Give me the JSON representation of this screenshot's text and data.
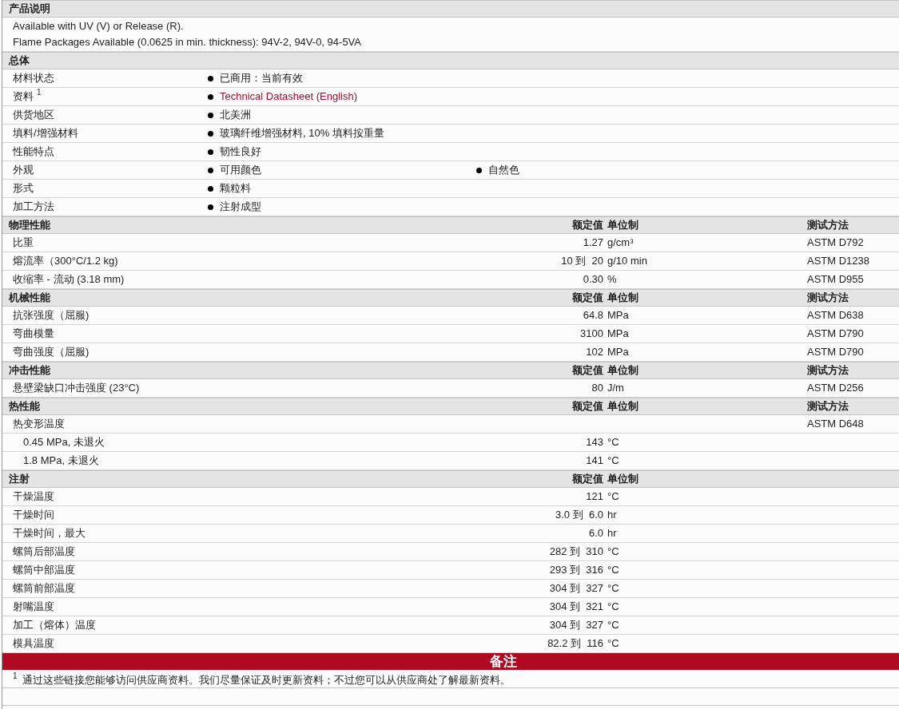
{
  "sections": [
    {
      "kind": "text",
      "title": "产品说明",
      "lines": [
        "Available with UV (V) or Release (R).",
        "Flame Packages Available (0.0625 in min. thickness): 94V-2, 94V-0, 94-5VA"
      ]
    },
    {
      "kind": "general",
      "title": "总体",
      "rows": [
        {
          "label": "材料状态",
          "values": [
            {
              "text": "已商用：当前有效",
              "link": false
            }
          ]
        },
        {
          "label": "资料",
          "footnote": "1",
          "values": [
            {
              "text": "Technical Datasheet (English)",
              "link": true
            }
          ]
        },
        {
          "label": "供货地区",
          "values": [
            {
              "text": "北美洲",
              "link": false
            }
          ]
        },
        {
          "label": "填料/增强材料",
          "values": [
            {
              "text": "玻璃纤维增强材料, 10% 填料按重量",
              "link": false
            }
          ]
        },
        {
          "label": "性能特点",
          "values": [
            {
              "text": "韧性良好",
              "link": false
            }
          ]
        },
        {
          "label": "外观",
          "values": [
            {
              "text": "可用颜色",
              "link": false
            },
            {
              "text": "自然色",
              "link": false
            }
          ]
        },
        {
          "label": "形式",
          "values": [
            {
              "text": "颗粒料",
              "link": false
            }
          ]
        },
        {
          "label": "加工方法",
          "values": [
            {
              "text": "注射成型",
              "link": false
            }
          ]
        }
      ]
    },
    {
      "kind": "props",
      "title": "物理性能",
      "headers": {
        "value": "额定值",
        "unit": "单位制",
        "method": "测试方法"
      },
      "rows": [
        {
          "label": "比重",
          "value": "1.27",
          "unit": "g/cm³",
          "method": "ASTM D792"
        },
        {
          "label": "熔流率（300°C/1.2 kg)",
          "value": "10 到  20",
          "unit": "g/10 min",
          "method": "ASTM D1238"
        },
        {
          "label": "收缩率 - 流动 (3.18 mm)",
          "value": "0.30",
          "unit": "%",
          "method": "ASTM D955"
        }
      ]
    },
    {
      "kind": "props",
      "title": "机械性能",
      "headers": {
        "value": "额定值",
        "unit": "单位制",
        "method": "测试方法"
      },
      "rows": [
        {
          "label": "抗张强度（屈服)",
          "value": "64.8",
          "unit": "MPa",
          "method": "ASTM D638"
        },
        {
          "label": "弯曲模量",
          "value": "3100",
          "unit": "MPa",
          "method": "ASTM D790"
        },
        {
          "label": "弯曲强度（屈服)",
          "value": "102",
          "unit": "MPa",
          "method": "ASTM D790"
        }
      ]
    },
    {
      "kind": "props",
      "title": "冲击性能",
      "headers": {
        "value": "额定值",
        "unit": "单位制",
        "method": "测试方法"
      },
      "rows": [
        {
          "label": "悬壁梁缺口冲击强度 (23°C)",
          "value": "80",
          "unit": "J/m",
          "method": "ASTM D256"
        }
      ]
    },
    {
      "kind": "props",
      "title": "热性能",
      "headers": {
        "value": "额定值",
        "unit": "单位制",
        "method": "测试方法"
      },
      "rows": [
        {
          "label": "热变形温度",
          "method": "ASTM D648",
          "children": [
            {
              "label": "0.45 MPa, 未退火",
              "value": "143",
              "unit": "°C"
            },
            {
              "label": "1.8 MPa, 未退火",
              "value": "141",
              "unit": "°C"
            }
          ]
        }
      ]
    },
    {
      "kind": "props",
      "title": "注射",
      "headers": {
        "value": "额定值",
        "unit": "单位制"
      },
      "rows": [
        {
          "label": "干燥温度",
          "value": "121",
          "unit": "°C"
        },
        {
          "label": "干燥时间",
          "value": "3.0 到  6.0",
          "unit": "hr"
        },
        {
          "label": "干燥时间，最大",
          "value": "6.0",
          "unit": "hr"
        },
        {
          "label": "螺筒后部温度",
          "value": "282 到  310",
          "unit": "°C"
        },
        {
          "label": "螺筒中部温度",
          "value": "293 到  316",
          "unit": "°C"
        },
        {
          "label": "螺筒前部温度",
          "value": "304 到  327",
          "unit": "°C"
        },
        {
          "label": "射嘴温度",
          "value": "304 到  321",
          "unit": "°C"
        },
        {
          "label": "加工（熔体）温度",
          "value": "304 到  327",
          "unit": "°C"
        },
        {
          "label": "模具温度",
          "value": "82.2 到  116",
          "unit": "°C"
        }
      ]
    }
  ],
  "notes": {
    "title": "备注",
    "footnotes": [
      {
        "mark": "1",
        "text": "通过这些链接您能够访问供应商资料。我们尽量保证及时更新资料；不过您可以从供应商处了解最新资料。"
      }
    ]
  }
}
